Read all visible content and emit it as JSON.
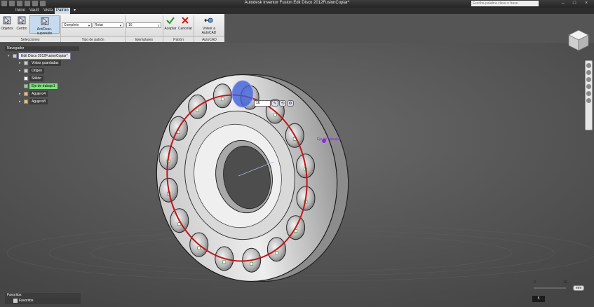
{
  "app": {
    "title": "Autodesk Inventor Fusion    Edit Disco 2012FusionCopiar*",
    "search_placeholder": "Escriba palabra clave o frase"
  },
  "menu": {
    "tabs": [
      "Inicio",
      "Vault",
      "Vista",
      "Patrón"
    ],
    "active": 3
  },
  "ribbon": {
    "selections": {
      "objects": "Objetos",
      "center": "Centro",
      "toggle": "Act/Desc. supresión",
      "group_label": "Selecciones"
    },
    "pattern_type": {
      "mode_value": "Completo",
      "orient_value": "Rotar",
      "group_label": "Tipo de patrón"
    },
    "instances": {
      "value": "16",
      "group_label": "Ejemplares"
    },
    "pattern": {
      "accept": "Aceptar",
      "cancel": "Cancelar",
      "group_label": "Patrón"
    },
    "autocad": {
      "back": "Volver a AutoCAD",
      "group_label": "AutoCAD"
    }
  },
  "navigator": {
    "header": "Navegador",
    "items": [
      {
        "label": "Edit Disco 2012FusionCopiar*"
      },
      {
        "label": "Vistas guardadas"
      },
      {
        "label": "Origen"
      },
      {
        "label": "Sólido"
      },
      {
        "label": "Eje de trabajo1"
      },
      {
        "label": "Agujero4"
      },
      {
        "label": "Agujero8"
      }
    ]
  },
  "favorites": {
    "header": "Favoritos",
    "item": "Favoritos"
  },
  "viewport": {
    "count_field": "16",
    "axis_label": "Eje de trabajo1",
    "slider_ticks": [
      "0",
      "10"
    ],
    "slider_value": "5",
    "slider_unit": "mm"
  },
  "colors": {
    "accent_green": "#7fe07f",
    "pattern_circle": "#c0161a",
    "axis_label": "#8a2be2",
    "selected_hole": "#3e5fd8"
  },
  "icons": [
    "undo-icon",
    "redo-icon",
    "save-icon",
    "check-icon",
    "x-icon",
    "arrow-back-icon",
    "viewcube-icon",
    "pan-icon",
    "zoom-icon",
    "orbit-icon"
  ]
}
